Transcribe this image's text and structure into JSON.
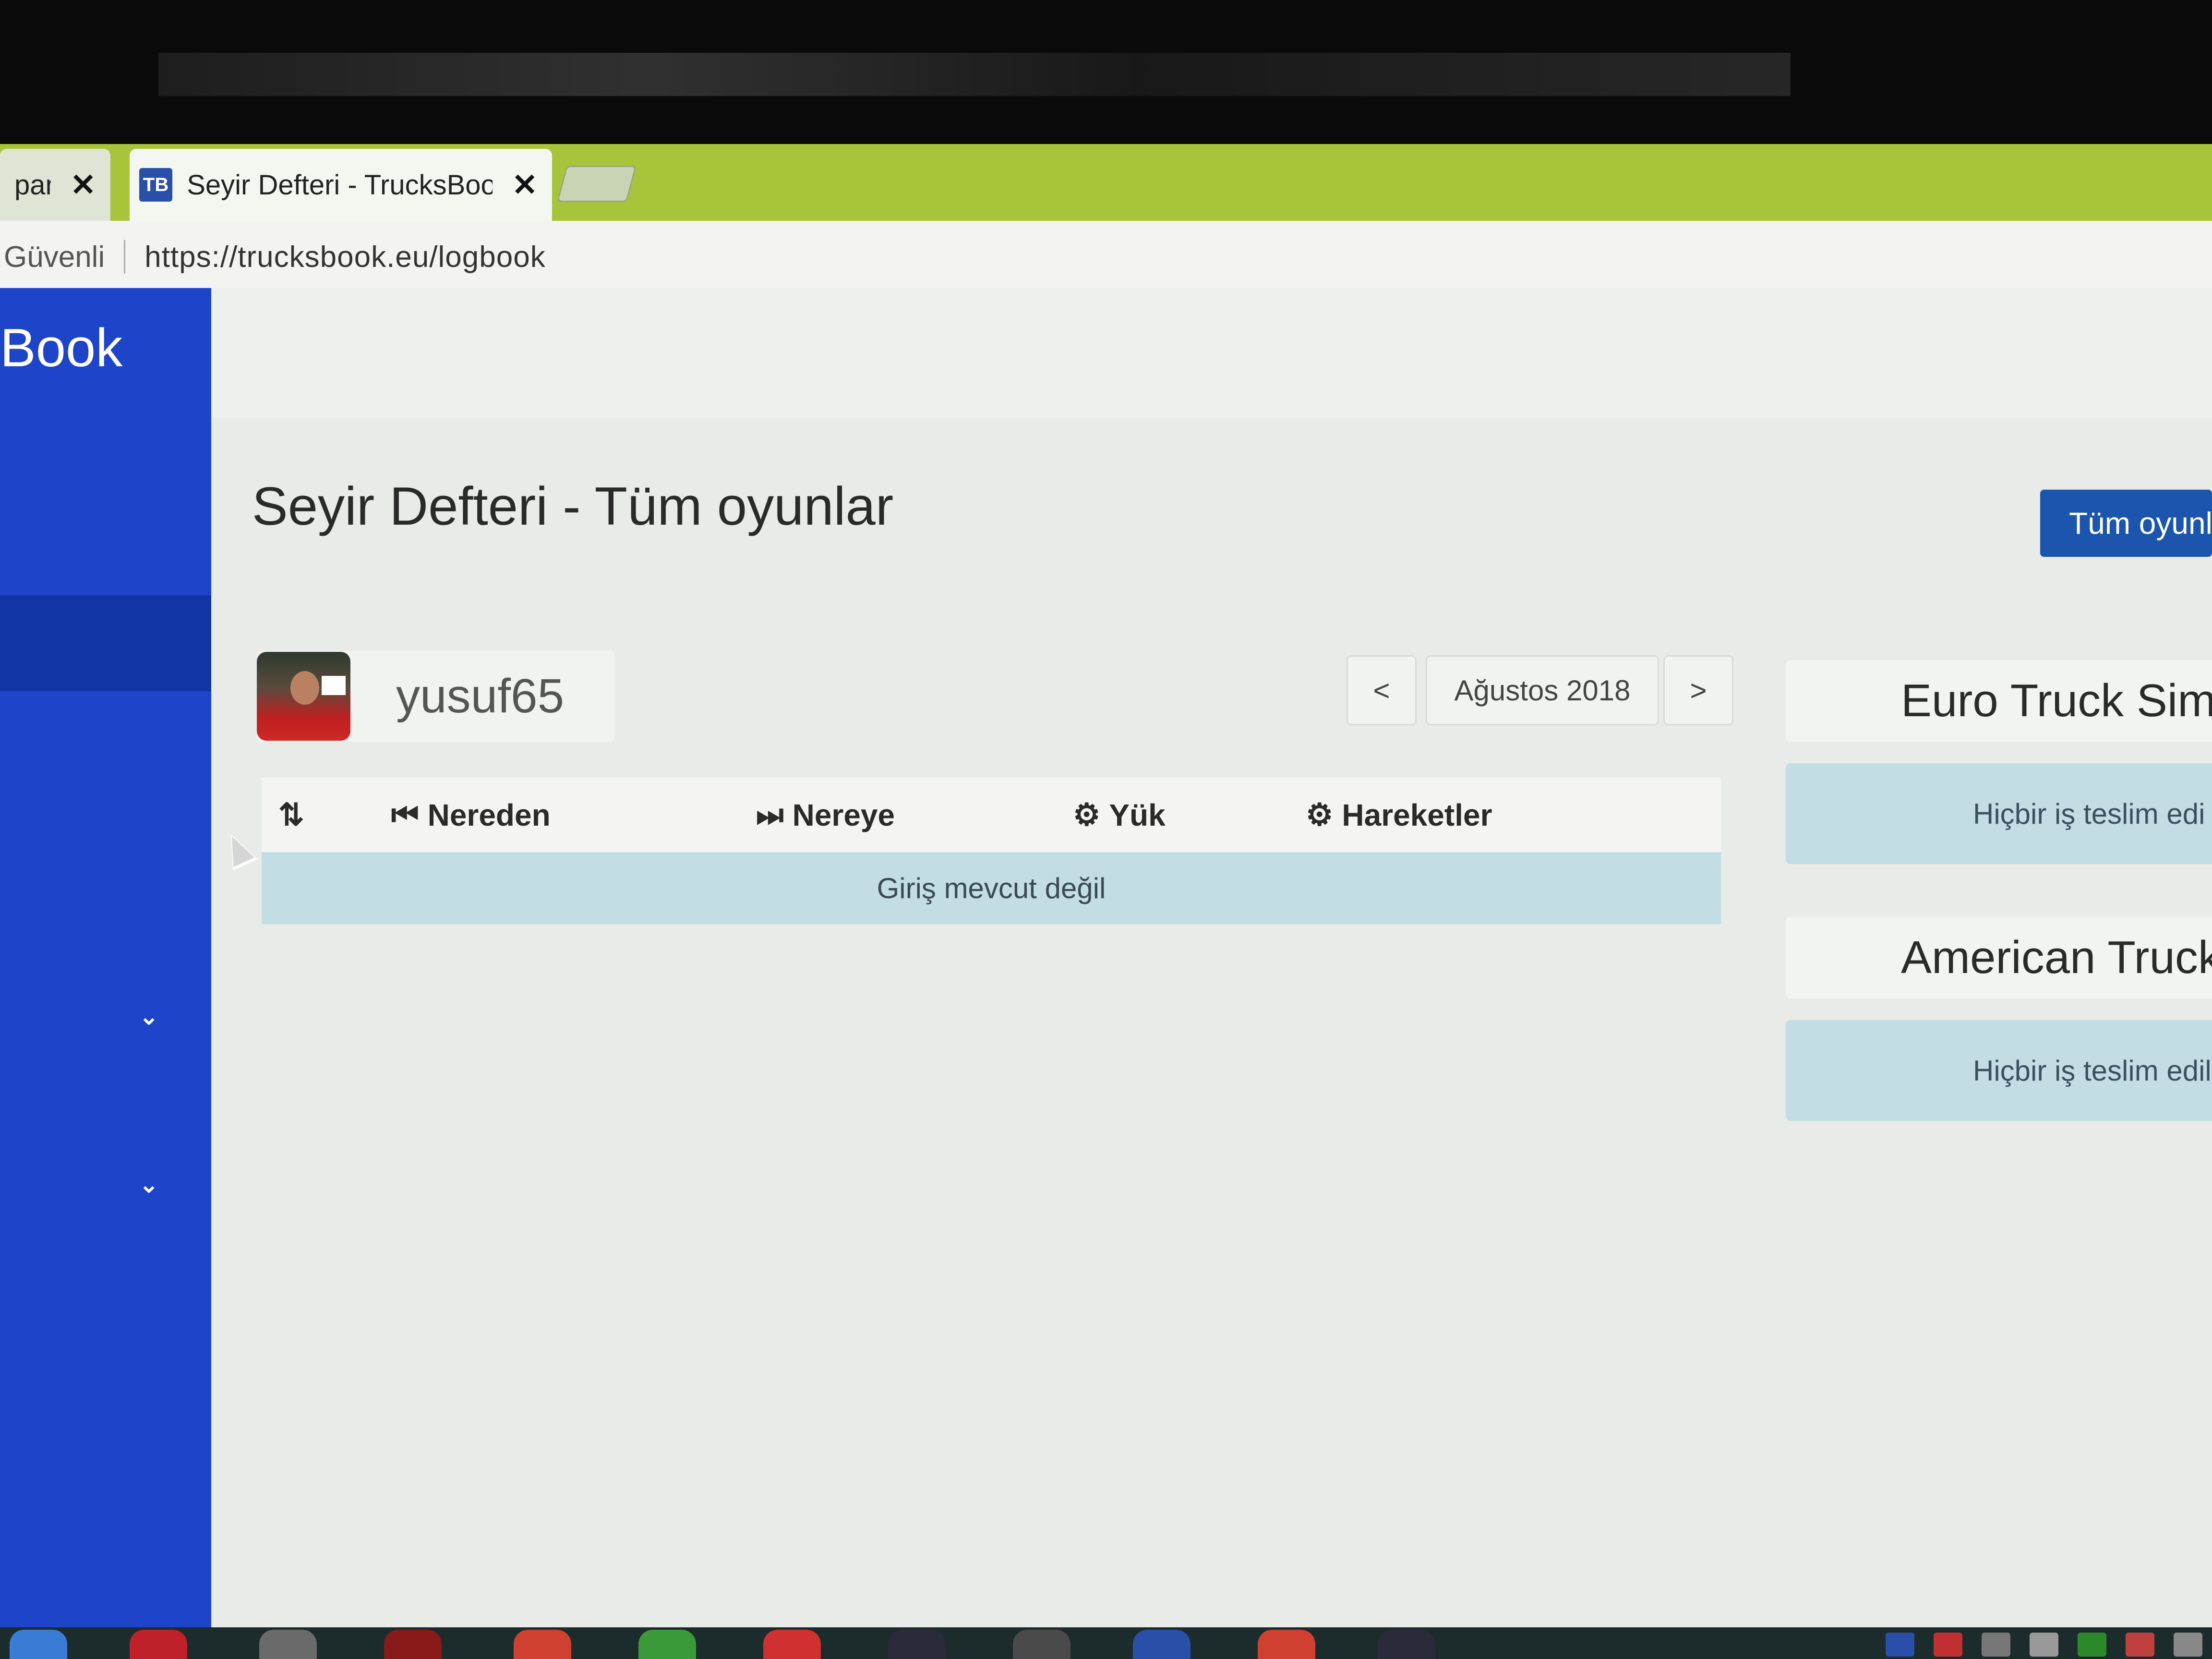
{
  "browser": {
    "tabs": [
      {
        "label": "pam",
        "close": "✕"
      },
      {
        "label": "Seyir Defteri - TrucksBoo",
        "favicon": "TB",
        "close": "✕"
      }
    ],
    "secure_label": "Güvenli",
    "url": "https://trucksbook.eu/logbook"
  },
  "sidebar": {
    "brand": "Book",
    "chevrons": [
      "⌄",
      "⌄"
    ]
  },
  "page": {
    "title": "Seyir Defteri - Tüm oyunlar",
    "all_games_button": "Tüm oyunl",
    "username": "yusuf65",
    "pager": {
      "prev": "<",
      "month": "Ağustos 2018",
      "next": ">"
    }
  },
  "table": {
    "columns": [
      {
        "icon": "⇅",
        "label": ""
      },
      {
        "icon": "⏮",
        "label": "Nereden"
      },
      {
        "icon": "⏭",
        "label": "Nereye"
      },
      {
        "icon": "⚙",
        "label": "Yük"
      },
      {
        "icon": "⚙",
        "label": "Hareketler"
      }
    ],
    "empty_message": "Giriş mevcut değil"
  },
  "side_panels": [
    {
      "title": "Euro Truck Sim",
      "message": "Hiçbir iş teslim edi"
    },
    {
      "title": "American Truck S",
      "message": "Hiçbir iş teslim edilı"
    }
  ],
  "colors": {
    "sidebar": "#1d44c9",
    "tabstrip": "#a8c43a",
    "button": "#1c55ad",
    "info_row": "#c2dde3"
  }
}
